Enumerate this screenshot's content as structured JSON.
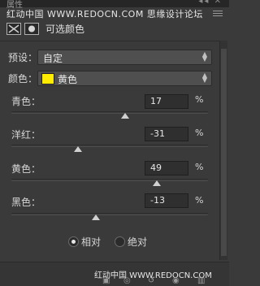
{
  "window": {
    "title": "属性",
    "controls": "◂◂ ✕"
  },
  "watermark_top": "红动中国 WWW.REDOCN.COM 思缘设计论坛",
  "panel": {
    "title": "可选颜色"
  },
  "preset": {
    "label": "预设：",
    "value": "自定"
  },
  "colors": {
    "label": "颜色：",
    "value": "黄色",
    "swatch_color": "#ffec00"
  },
  "sliders": [
    {
      "label": "青色：",
      "value": "17",
      "unit": "%",
      "handle_fraction": 0.58
    },
    {
      "label": "洋红：",
      "value": "-31",
      "unit": "%",
      "handle_fraction": 0.34
    },
    {
      "label": "黄色：",
      "value": "49",
      "unit": "%",
      "handle_fraction": 0.74
    },
    {
      "label": "黑色：",
      "value": "-13",
      "unit": "%",
      "handle_fraction": 0.43
    }
  ],
  "method": {
    "options": [
      "相对",
      "绝对"
    ],
    "selected": "相对"
  },
  "watermark_bottom": "红动中国 WWW.REDOCN.COM",
  "bottom_icons": [
    "clip-icon",
    "view-previous-icon",
    "reset-icon",
    "visibility-icon",
    "trash-icon"
  ]
}
